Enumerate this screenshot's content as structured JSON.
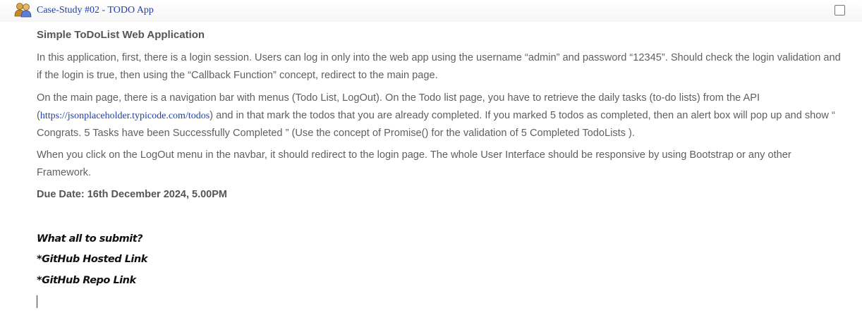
{
  "header": {
    "title": "Case-Study #02 - TODO App",
    "icon": "users-icon"
  },
  "main": {
    "heading": "Simple ToDoList Web Application",
    "p1": "In this application, first, there is a login session. Users can log in only into the web app using the username “admin” and password “12345”. Should check the login validation and if the login is true, then using the “Callback Function” concept, redirect to the main page.",
    "p2_before": "On the main page, there is a navigation bar with menus (Todo List, LogOut). On the Todo list page, you have to retrieve the daily tasks (to-do lists) from the API (",
    "p2_link": "https://jsonplaceholder.typicode.com/todos",
    "p2_after": ") and in that mark the todos that you are already completed. If you marked 5 todos as completed, then an alert box will pop up and show “ Congrats. 5 Tasks have been Successfully Completed ” (Use the concept of Promise() for the validation of 5 Completed TodoLists ).",
    "p3": "When you click on the LogOut menu in the navbar, it should redirect to the login page. The whole User Interface should be responsive by using Bootstrap or any other Framework.",
    "due": "Due Date: 16th December 2024, 5.00PM",
    "submit_heading": "What all to submit?",
    "submit_items": [
      "*GitHub Hosted Link",
      "*GitHub Repo Link"
    ]
  }
}
